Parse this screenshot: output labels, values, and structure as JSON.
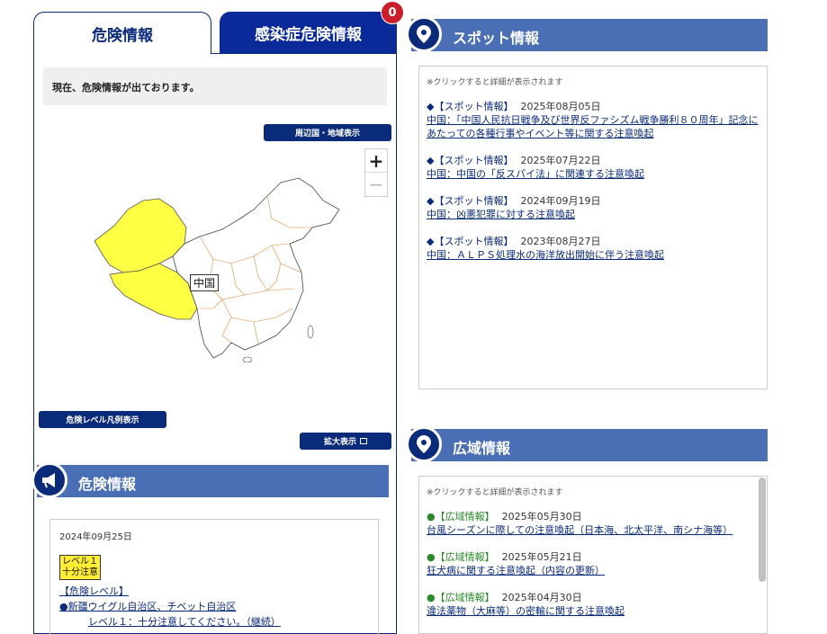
{
  "tabs": {
    "active": "危険情報",
    "inactive": "感染症危険情報",
    "badge_count": "0"
  },
  "notice": "現在、危険情報が出ております。",
  "map": {
    "neighbors_button": "周辺国・地域表示",
    "legend_button": "危険レベル凡例表示",
    "enlarge_button": "拡大表示",
    "zoom_in": "+",
    "zoom_out": "−",
    "country_label": "中国",
    "level1_color": "#ffff44"
  },
  "danger": {
    "heading": "危険情報",
    "date": "2024年09月25日",
    "level_badge_line1": "レベル１",
    "level_badge_line2": "十分注意",
    "link1": "【危険レベル】",
    "link2": "●新疆ウイグル自治区、チベット自治区",
    "link3": "レベル１：十分注意してください。（継続）"
  },
  "spot": {
    "heading": "スポット情報",
    "hint": "※クリックすると詳細が表示されます",
    "items": [
      {
        "tag": "◆【スポット情報】",
        "date": "2025年08月05日",
        "title": "中国：「中国人民抗日戦争及び世界反ファシズム戦争勝利８０周年」記念にあたっての各種行事やイベント等に関する注意喚起"
      },
      {
        "tag": "◆【スポット情報】",
        "date": "2025年07月22日",
        "title": "中国：中国の「反スパイ法」に関連する注意喚起"
      },
      {
        "tag": "◆【スポット情報】",
        "date": "2024年09月19日",
        "title": "中国：凶悪犯罪に対する注意喚起"
      },
      {
        "tag": "◆【スポット情報】",
        "date": "2023年08月27日",
        "title": "中国：ＡＬＰＳ処理水の海洋放出開始に伴う注意喚起"
      }
    ]
  },
  "area": {
    "heading": "広域情報",
    "hint": "※クリックすると詳細が表示されます",
    "items": [
      {
        "tag": "●【広域情報】",
        "date": "2025年05月30日",
        "title": "台風シーズンに際しての注意喚起（日本海、北太平洋、南シナ海等）"
      },
      {
        "tag": "●【広域情報】",
        "date": "2025年05月21日",
        "title": "狂犬病に関する注意喚起（内容の更新）"
      },
      {
        "tag": "●【広域情報】",
        "date": "2025年04月30日",
        "title": "違法薬物（大麻等）の密輸に関する注意喚起"
      }
    ]
  }
}
